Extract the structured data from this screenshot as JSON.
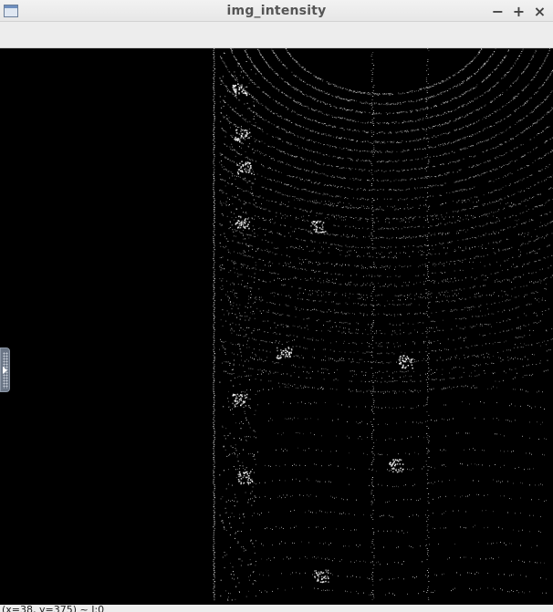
{
  "window": {
    "title": "img_intensity",
    "controls": {
      "minimize": "−",
      "maximize": "+",
      "close": "×"
    },
    "icon": "window-app-icon"
  },
  "side_panel": {
    "icon": "panel-expand-icon"
  },
  "status": {
    "text": "(x=38, y=375) ~ I:0"
  },
  "image": {
    "description_hidden": "",
    "background": "#000000",
    "point_color": "#ffffff"
  }
}
